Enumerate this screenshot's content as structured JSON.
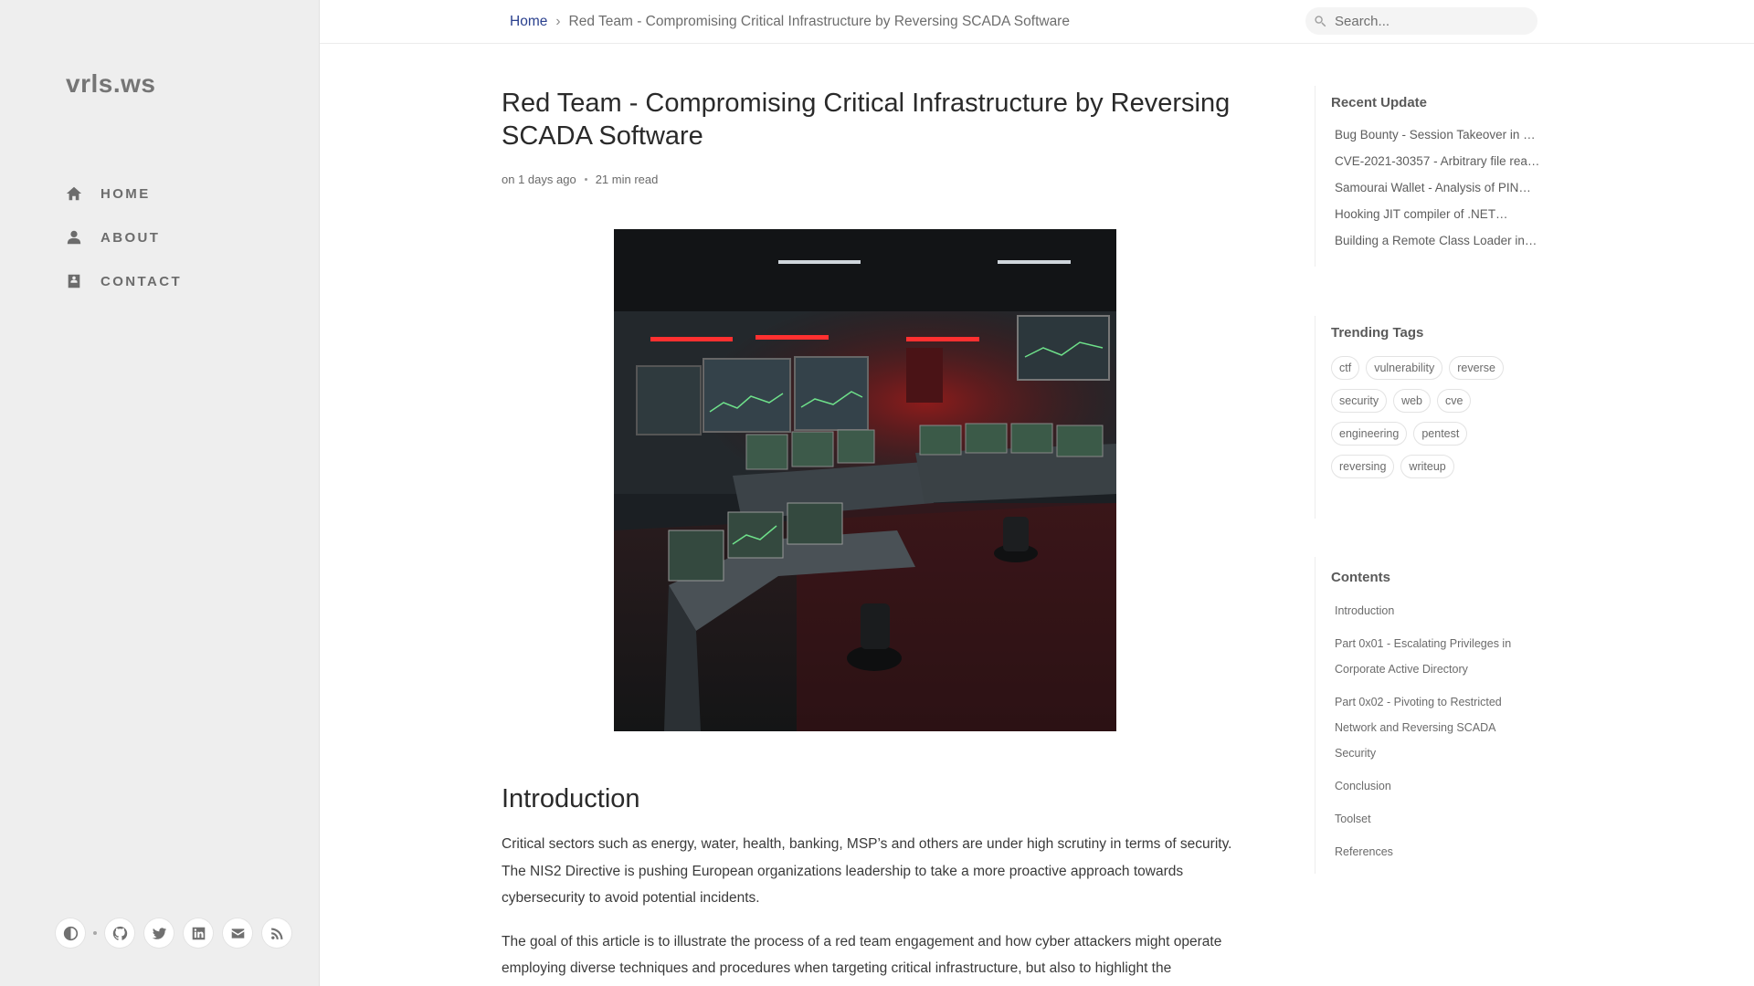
{
  "site": {
    "title": "vrls.ws"
  },
  "nav": [
    {
      "label": "HOME",
      "icon": "home-icon"
    },
    {
      "label": "ABOUT",
      "icon": "user-icon"
    },
    {
      "label": "CONTACT",
      "icon": "contact-book-icon"
    }
  ],
  "sidebar_bottom": {
    "buttons": [
      {
        "name": "theme-toggle-button",
        "icon": "contrast-icon"
      },
      {
        "name": "github-button",
        "icon": "github-icon"
      },
      {
        "name": "twitter-button",
        "icon": "twitter-icon"
      },
      {
        "name": "linkedin-button",
        "icon": "linkedin-icon"
      },
      {
        "name": "email-button",
        "icon": "envelope-icon"
      },
      {
        "name": "rss-button",
        "icon": "rss-icon"
      }
    ]
  },
  "breadcrumb": {
    "home": "Home",
    "separator": "›",
    "current": "Red Team - Compromising Critical Infrastructure by Reversing SCADA Software"
  },
  "search": {
    "placeholder": "Search..."
  },
  "post": {
    "title": "Red Team - Compromising Critical Infrastructure by Reversing SCADA Software",
    "date": "on 1 days ago",
    "read_time": "21 min read",
    "hero_image": "scada-control-room-image",
    "intro_heading": "Introduction",
    "paragraphs": [
      "Critical sectors such as energy, water, health, banking, MSP’s and others are under high scrutiny in terms of security. The NIS2 Directive is pushing European organizations leadership to take a more proactive approach towards cybersecurity to avoid potential incidents.",
      "The goal of this article is to illustrate the process of a red team engagement and how cyber attackers might operate employing diverse techniques and procedures when targeting critical infrastructure, but also to highlight the"
    ]
  },
  "panel": {
    "recent": {
      "heading": "Recent Update",
      "items": [
        "Bug Bounty - Session Takeover in B…",
        "CVE-2021-30357 - Arbitrary file read …",
        "Samourai Wallet - Analysis of PIN…",
        "Hooking JIT compiler of .NET…",
        "Building a Remote Class Loader in…"
      ]
    },
    "tags": {
      "heading": "Trending Tags",
      "items": [
        "ctf",
        "vulnerability",
        "reverse",
        "security",
        "web",
        "cve",
        "engineering",
        "pentest",
        "reversing",
        "writeup"
      ]
    },
    "toc": {
      "heading": "Contents",
      "items": [
        "Introduction",
        "Part 0x01 - Escalating Privileges in Corporate Active Directory",
        "Part 0x02 - Pivoting to Restricted Network and Reversing SCADA Security",
        "Conclusion",
        "Toolset",
        "References"
      ]
    }
  },
  "colors": {
    "accent_link": "#2a408e",
    "sidebar_bg": "#eeeeee"
  }
}
